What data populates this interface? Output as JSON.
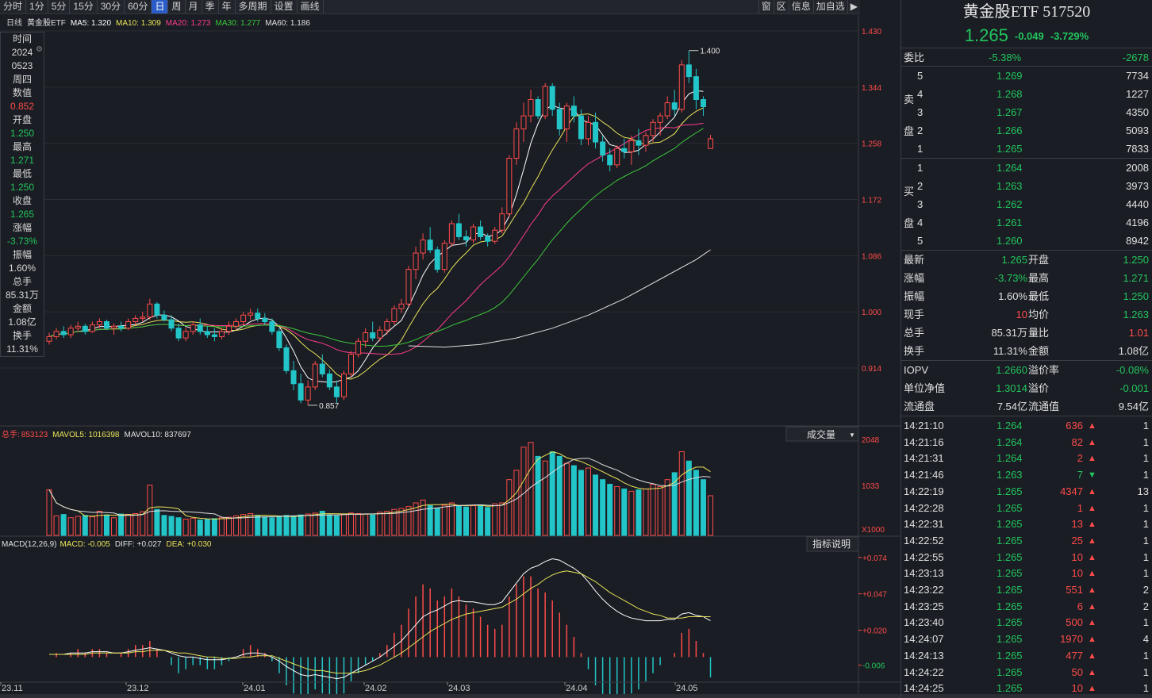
{
  "toolbar": {
    "periods": [
      "分时",
      "1分",
      "5分",
      "15分",
      "30分",
      "60分",
      "日",
      "周",
      "月",
      "季",
      "年",
      "多周期",
      "设置",
      "画线"
    ],
    "active": "日",
    "right": [
      "窗",
      "区",
      "信息",
      "加自选"
    ]
  },
  "ma_legend": {
    "period": "日线",
    "name": "黄金股ETF",
    "ma5": "MA5: 1.320",
    "ma10": "MA10: 1.309",
    "ma20": "MA20: 1.273",
    "ma30": "MA30: 1.277",
    "ma60": "MA60: 1.186"
  },
  "price_axis": [
    "1.430",
    "1.344",
    "1.258",
    "1.172",
    "1.086",
    "1.000",
    "0.914"
  ],
  "high_label": "1.400",
  "low_label": "0.857",
  "side_info": [
    [
      "时间",
      "l"
    ],
    [
      "2024",
      "l"
    ],
    [
      "0523",
      "l"
    ],
    [
      "周四",
      "l"
    ],
    [
      "数值",
      "l"
    ],
    [
      "0.852",
      "r"
    ],
    [
      "开盘",
      "l"
    ],
    [
      "1.250",
      "g"
    ],
    [
      "最高",
      "l"
    ],
    [
      "1.271",
      "g"
    ],
    [
      "最低",
      "l"
    ],
    [
      "1.250",
      "g"
    ],
    [
      "收盘",
      "l"
    ],
    [
      "1.265",
      "g"
    ],
    [
      "涨幅",
      "l"
    ],
    [
      "-3.73%",
      "g"
    ],
    [
      "振幅",
      "l"
    ],
    [
      "1.60%",
      "l"
    ],
    [
      "总手",
      "l"
    ],
    [
      "85.31万",
      "l"
    ],
    [
      "金额",
      "l"
    ],
    [
      "1.08亿",
      "l"
    ],
    [
      "换手",
      "l"
    ],
    [
      "11.31%",
      "l"
    ]
  ],
  "vol_legend": {
    "label": "总手:",
    "value": "853123",
    "mavol5": "MAVOL5: 1016398",
    "mavol10": "MAVOL10: 837697",
    "dropdown": "成交量"
  },
  "vol_axis": [
    "2048",
    "1033",
    "X1000"
  ],
  "macd_legend": {
    "title": "MACD(12,26,9)",
    "macd": "MACD: -0.005",
    "diff": "DIFF: +0.027",
    "dea": "DEA: +0.030",
    "button": "指标说明"
  },
  "macd_axis": [
    "+0.074",
    "+0.047",
    "+0.020",
    "-0.006"
  ],
  "date_axis": [
    "23.11",
    "23.12",
    "24.01",
    "24.02",
    "24.03",
    "24.04",
    "24.05"
  ],
  "quote": {
    "title": "黄金股ETF 517520",
    "price": "1.265",
    "change": "-0.049",
    "pct": "-3.729%",
    "weibi": {
      "label": "委比",
      "pct": "-5.38%",
      "diff": "-2678"
    },
    "sell_label": [
      "卖",
      "盘"
    ],
    "buy_label": [
      "买",
      "盘"
    ],
    "sell": [
      [
        "5",
        "1.269",
        "7734"
      ],
      [
        "4",
        "1.268",
        "1227"
      ],
      [
        "3",
        "1.267",
        "4350"
      ],
      [
        "2",
        "1.266",
        "5093"
      ],
      [
        "1",
        "1.265",
        "7833"
      ]
    ],
    "buy": [
      [
        "1",
        "1.264",
        "2008"
      ],
      [
        "2",
        "1.263",
        "3973"
      ],
      [
        "3",
        "1.262",
        "4440"
      ],
      [
        "4",
        "1.261",
        "4196"
      ],
      [
        "5",
        "1.260",
        "8942"
      ]
    ],
    "stats": [
      [
        "最新",
        "1.265",
        "开盘",
        "1.250",
        "green",
        "green"
      ],
      [
        "涨幅",
        "-3.73%",
        "最高",
        "1.271",
        "green",
        "green"
      ],
      [
        "振幅",
        "1.60%",
        "最低",
        "1.250",
        "white",
        "green"
      ],
      [
        "现手",
        "10",
        "均价",
        "1.263",
        "red",
        "green"
      ],
      [
        "总手",
        "85.31万",
        "量比",
        "1.01",
        "white",
        "red"
      ],
      [
        "换手",
        "11.31%",
        "金额",
        "1.08亿",
        "white",
        "white"
      ]
    ],
    "nav": [
      [
        "IOPV",
        "1.2660",
        "溢价率",
        "-0.08%",
        "green",
        "green"
      ],
      [
        "单位净值",
        "1.3014",
        "溢价",
        "-0.001",
        "green",
        "green"
      ],
      [
        "流通盘",
        "7.54亿",
        "流通值",
        "9.54亿",
        "white",
        "white"
      ]
    ],
    "ticks": [
      [
        "14:21:10",
        "1.264",
        "636",
        "up",
        "1"
      ],
      [
        "14:21:16",
        "1.264",
        "82",
        "up",
        "1"
      ],
      [
        "14:21:31",
        "1.264",
        "2",
        "up",
        "1"
      ],
      [
        "14:21:46",
        "1.263",
        "7",
        "down",
        "1"
      ],
      [
        "14:22:19",
        "1.265",
        "4347",
        "up",
        "13"
      ],
      [
        "14:22:28",
        "1.265",
        "1",
        "up",
        "1"
      ],
      [
        "14:22:31",
        "1.265",
        "13",
        "up",
        "1"
      ],
      [
        "14:22:52",
        "1.265",
        "25",
        "up",
        "1"
      ],
      [
        "14:22:55",
        "1.265",
        "10",
        "up",
        "1"
      ],
      [
        "14:23:13",
        "1.265",
        "10",
        "up",
        "1"
      ],
      [
        "14:23:22",
        "1.265",
        "551",
        "up",
        "2"
      ],
      [
        "14:23:25",
        "1.265",
        "6",
        "up",
        "2"
      ],
      [
        "14:23:40",
        "1.265",
        "500",
        "up",
        "1"
      ],
      [
        "14:24:07",
        "1.265",
        "1970",
        "up",
        "4"
      ],
      [
        "14:24:13",
        "1.265",
        "477",
        "up",
        "1"
      ],
      [
        "14:24:22",
        "1.265",
        "50",
        "up",
        "1"
      ],
      [
        "14:24:25",
        "1.265",
        "10",
        "up",
        "1"
      ]
    ]
  },
  "colors": {
    "up": "#ff4b4b",
    "down": "#22c5c8",
    "ma5": "#ffffff",
    "ma10": "#e8e35a",
    "ma20": "#ff3c8c",
    "ma30": "#3cc83c",
    "ma60": "#e0e0e0"
  },
  "chart_data": {
    "type": "candlestick",
    "price_ylim": [
      0.857,
      1.43
    ],
    "candles": [
      [
        0.955,
        0.968,
        0.95,
        0.962
      ],
      [
        0.962,
        0.975,
        0.958,
        0.97
      ],
      [
        0.97,
        0.978,
        0.96,
        0.965
      ],
      [
        0.965,
        0.98,
        0.96,
        0.975
      ],
      [
        0.975,
        0.985,
        0.97,
        0.978
      ],
      [
        0.978,
        0.982,
        0.965,
        0.97
      ],
      [
        0.97,
        0.985,
        0.968,
        0.98
      ],
      [
        0.98,
        0.99,
        0.975,
        0.985
      ],
      [
        0.985,
        0.988,
        0.972,
        0.975
      ],
      [
        0.975,
        0.982,
        0.965,
        0.978
      ],
      [
        0.978,
        0.985,
        0.97,
        0.975
      ],
      [
        0.975,
        0.99,
        0.972,
        0.985
      ],
      [
        0.985,
        0.995,
        0.98,
        0.99
      ],
      [
        0.99,
        1.0,
        0.985,
        0.992
      ],
      [
        0.992,
        1.02,
        0.988,
        1.012
      ],
      [
        1.012,
        1.015,
        0.99,
        0.995
      ],
      [
        0.995,
        1.002,
        0.985,
        0.988
      ],
      [
        0.988,
        0.995,
        0.97,
        0.975
      ],
      [
        0.975,
        0.982,
        0.955,
        0.96
      ],
      [
        0.96,
        0.975,
        0.955,
        0.97
      ],
      [
        0.97,
        0.985,
        0.965,
        0.98
      ],
      [
        0.98,
        0.99,
        0.965,
        0.97
      ],
      [
        0.97,
        0.978,
        0.96,
        0.965
      ],
      [
        0.965,
        0.975,
        0.955,
        0.962
      ],
      [
        0.962,
        0.975,
        0.958,
        0.97
      ],
      [
        0.97,
        0.985,
        0.965,
        0.978
      ],
      [
        0.978,
        0.99,
        0.972,
        0.985
      ],
      [
        0.985,
        1.0,
        0.98,
        0.995
      ],
      [
        0.995,
        1.005,
        0.988,
        0.998
      ],
      [
        0.998,
        1.005,
        0.985,
        0.99
      ],
      [
        0.99,
        0.998,
        0.98,
        0.985
      ],
      [
        0.985,
        0.99,
        0.965,
        0.97
      ],
      [
        0.97,
        0.975,
        0.94,
        0.945
      ],
      [
        0.945,
        0.95,
        0.905,
        0.91
      ],
      [
        0.91,
        0.925,
        0.88,
        0.89
      ],
      [
        0.89,
        0.905,
        0.86,
        0.865
      ],
      [
        0.865,
        0.895,
        0.857,
        0.885
      ],
      [
        0.885,
        0.925,
        0.88,
        0.92
      ],
      [
        0.92,
        0.935,
        0.9,
        0.905
      ],
      [
        0.905,
        0.912,
        0.88,
        0.885
      ],
      [
        0.885,
        0.895,
        0.86,
        0.87
      ],
      [
        0.87,
        0.91,
        0.865,
        0.905
      ],
      [
        0.905,
        0.94,
        0.9,
        0.935
      ],
      [
        0.935,
        0.96,
        0.93,
        0.955
      ],
      [
        0.955,
        0.975,
        0.945,
        0.968
      ],
      [
        0.968,
        0.985,
        0.955,
        0.96
      ],
      [
        0.96,
        0.978,
        0.955,
        0.972
      ],
      [
        0.972,
        0.99,
        0.965,
        0.985
      ],
      [
        0.985,
        1.01,
        0.98,
        1.005
      ],
      [
        1.005,
        1.02,
        0.998,
        1.012
      ],
      [
        1.012,
        1.07,
        1.008,
        1.065
      ],
      [
        1.065,
        1.1,
        1.05,
        1.09
      ],
      [
        1.09,
        1.12,
        1.08,
        1.11
      ],
      [
        1.11,
        1.13,
        1.09,
        1.095
      ],
      [
        1.095,
        1.1,
        1.06,
        1.065
      ],
      [
        1.065,
        1.11,
        1.06,
        1.105
      ],
      [
        1.105,
        1.14,
        1.1,
        1.135
      ],
      [
        1.135,
        1.15,
        1.11,
        1.115
      ],
      [
        1.115,
        1.125,
        1.1,
        1.11
      ],
      [
        1.11,
        1.135,
        1.105,
        1.13
      ],
      [
        1.13,
        1.14,
        1.11,
        1.115
      ],
      [
        1.115,
        1.12,
        1.1,
        1.108
      ],
      [
        1.108,
        1.13,
        1.104,
        1.125
      ],
      [
        1.125,
        1.16,
        1.12,
        1.15
      ],
      [
        1.15,
        1.24,
        1.145,
        1.235
      ],
      [
        1.235,
        1.29,
        1.225,
        1.28
      ],
      [
        1.28,
        1.32,
        1.26,
        1.3
      ],
      [
        1.3,
        1.34,
        1.29,
        1.325
      ],
      [
        1.325,
        1.33,
        1.295,
        1.3
      ],
      [
        1.3,
        1.35,
        1.295,
        1.345
      ],
      [
        1.345,
        1.35,
        1.3,
        1.31
      ],
      [
        1.31,
        1.32,
        1.27,
        1.28
      ],
      [
        1.28,
        1.32,
        1.26,
        1.315
      ],
      [
        1.315,
        1.33,
        1.29,
        1.3
      ],
      [
        1.3,
        1.31,
        1.255,
        1.265
      ],
      [
        1.265,
        1.3,
        1.255,
        1.29
      ],
      [
        1.29,
        1.305,
        1.25,
        1.26
      ],
      [
        1.26,
        1.27,
        1.23,
        1.24
      ],
      [
        1.24,
        1.25,
        1.215,
        1.225
      ],
      [
        1.225,
        1.255,
        1.22,
        1.25
      ],
      [
        1.25,
        1.265,
        1.235,
        1.245
      ],
      [
        1.245,
        1.27,
        1.225,
        1.262
      ],
      [
        1.262,
        1.28,
        1.24,
        1.255
      ],
      [
        1.255,
        1.275,
        1.245,
        1.27
      ],
      [
        1.27,
        1.295,
        1.26,
        1.29
      ],
      [
        1.29,
        1.305,
        1.27,
        1.3
      ],
      [
        1.3,
        1.33,
        1.295,
        1.32
      ],
      [
        1.32,
        1.34,
        1.3,
        1.31
      ],
      [
        1.31,
        1.385,
        1.305,
        1.378
      ],
      [
        1.378,
        1.4,
        1.35,
        1.36
      ],
      [
        1.36,
        1.372,
        1.31,
        1.325
      ],
      [
        1.325,
        1.33,
        1.3,
        1.314
      ],
      [
        1.25,
        1.271,
        1.25,
        1.265
      ]
    ],
    "ma60": [
      [
        50,
        0.948
      ],
      [
        55,
        0.946
      ],
      [
        60,
        0.95
      ],
      [
        65,
        0.96
      ],
      [
        70,
        0.975
      ],
      [
        75,
        0.995
      ],
      [
        80,
        1.02
      ],
      [
        85,
        1.05
      ],
      [
        90,
        1.08
      ],
      [
        92,
        1.095
      ]
    ],
    "volume_ylim": [
      0,
      2048
    ],
    "volume": [
      980,
      420,
      450,
      380,
      410,
      430,
      400,
      520,
      440,
      380,
      460,
      450,
      470,
      510,
      1080,
      560,
      430,
      410,
      380,
      350,
      370,
      330,
      350,
      360,
      380,
      390,
      420,
      450,
      470,
      430,
      400,
      380,
      410,
      430,
      420,
      440,
      460,
      480,
      520,
      440,
      420,
      450,
      480,
      470,
      460,
      440,
      500,
      520,
      560,
      580,
      620,
      700,
      760,
      640,
      590,
      650,
      700,
      640,
      610,
      640,
      650,
      600,
      680,
      700,
      1200,
      1400,
      1900,
      2000,
      1700,
      1600,
      1800,
      1700,
      1550,
      1500,
      1400,
      1450,
      1300,
      1200,
      1100,
      1050,
      1000,
      950,
      980,
      1000,
      1100,
      1050,
      1200,
      1350,
      1800,
      1600,
      1400,
      1200,
      853
    ],
    "macd_ylim": [
      -0.018,
      0.078
    ],
    "macd": [
      0.0,
      0.001,
      0.0,
      0.001,
      0.002,
      0.001,
      0.002,
      0.002,
      0.001,
      0.0,
      0.001,
      0.002,
      0.003,
      0.003,
      0.004,
      0.002,
      0.0,
      -0.002,
      -0.004,
      -0.003,
      -0.002,
      -0.002,
      -0.003,
      -0.003,
      -0.002,
      -0.001,
      0.0,
      0.002,
      0.003,
      0.002,
      0.001,
      -0.001,
      -0.004,
      -0.007,
      -0.009,
      -0.011,
      -0.01,
      -0.008,
      -0.009,
      -0.01,
      -0.011,
      -0.009,
      -0.006,
      -0.004,
      -0.002,
      -0.001,
      0.001,
      0.003,
      0.006,
      0.008,
      0.012,
      0.015,
      0.018,
      0.017,
      0.014,
      0.015,
      0.017,
      0.015,
      0.013,
      0.012,
      0.01,
      0.008,
      0.007,
      0.008,
      0.015,
      0.018,
      0.02,
      0.02,
      0.017,
      0.016,
      0.014,
      0.011,
      0.008,
      0.005,
      0.001,
      -0.003,
      -0.007,
      -0.01,
      -0.012,
      -0.012,
      -0.011,
      -0.009,
      -0.008,
      -0.006,
      -0.004,
      -0.002,
      0.0,
      0.001,
      0.006,
      0.007,
      0.004,
      0.001,
      -0.005
    ],
    "diff": [
      0.002,
      0.002,
      0.002,
      0.003,
      0.003,
      0.003,
      0.004,
      0.004,
      0.004,
      0.003,
      0.003,
      0.004,
      0.005,
      0.006,
      0.007,
      0.006,
      0.005,
      0.003,
      0.001,
      0.0,
      0.0,
      -0.001,
      -0.002,
      -0.002,
      -0.002,
      -0.001,
      0.0,
      0.002,
      0.003,
      0.003,
      0.002,
      0.0,
      -0.003,
      -0.007,
      -0.01,
      -0.013,
      -0.014,
      -0.013,
      -0.014,
      -0.015,
      -0.016,
      -0.015,
      -0.012,
      -0.009,
      -0.006,
      -0.003,
      0.0,
      0.004,
      0.008,
      0.012,
      0.018,
      0.024,
      0.03,
      0.033,
      0.035,
      0.038,
      0.041,
      0.042,
      0.041,
      0.041,
      0.04,
      0.039,
      0.039,
      0.041,
      0.048,
      0.055,
      0.062,
      0.066,
      0.068,
      0.071,
      0.073,
      0.072,
      0.069,
      0.066,
      0.062,
      0.056,
      0.049,
      0.043,
      0.038,
      0.034,
      0.031,
      0.029,
      0.028,
      0.027,
      0.027,
      0.027,
      0.028,
      0.028,
      0.032,
      0.033,
      0.031,
      0.03,
      0.027
    ],
    "dea": [
      0.002,
      0.002,
      0.002,
      0.002,
      0.002,
      0.002,
      0.003,
      0.003,
      0.003,
      0.003,
      0.003,
      0.003,
      0.004,
      0.004,
      0.005,
      0.005,
      0.005,
      0.004,
      0.003,
      0.003,
      0.002,
      0.001,
      0.0,
      0.0,
      -0.001,
      -0.001,
      -0.001,
      0.0,
      0.0,
      0.001,
      0.001,
      0.001,
      -0.001,
      -0.003,
      -0.005,
      -0.007,
      -0.009,
      -0.01,
      -0.01,
      -0.011,
      -0.012,
      -0.012,
      -0.012,
      -0.011,
      -0.01,
      -0.008,
      -0.006,
      -0.003,
      0.0,
      0.003,
      0.007,
      0.011,
      0.015,
      0.019,
      0.022,
      0.025,
      0.028,
      0.03,
      0.032,
      0.033,
      0.034,
      0.035,
      0.036,
      0.037,
      0.04,
      0.043,
      0.047,
      0.051,
      0.054,
      0.058,
      0.061,
      0.063,
      0.064,
      0.063,
      0.062,
      0.059,
      0.056,
      0.052,
      0.048,
      0.045,
      0.042,
      0.039,
      0.036,
      0.034,
      0.032,
      0.031,
      0.029,
      0.029,
      0.029,
      0.03,
      0.03,
      0.03,
      0.03
    ]
  }
}
